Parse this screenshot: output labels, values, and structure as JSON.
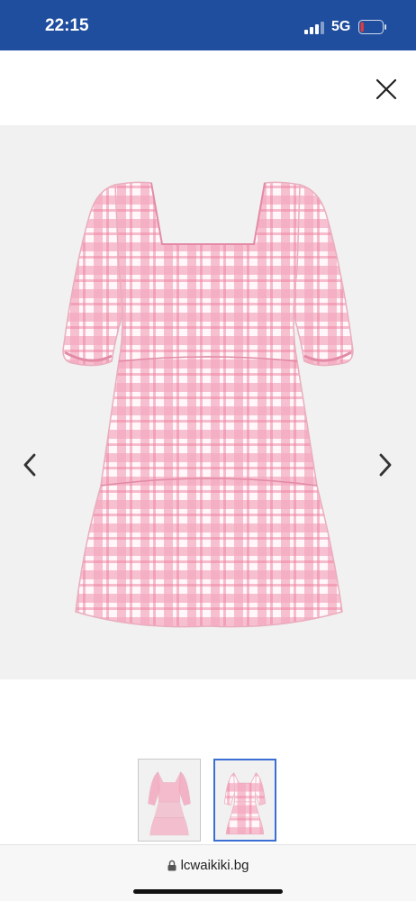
{
  "status_bar": {
    "time": "22:15",
    "network": "5G",
    "icons": [
      "signal-bars-icon",
      "battery-low-icon"
    ],
    "battery_level": 0.15,
    "colors": {
      "background": "#1f4e9e",
      "battery_fill": "#e23b3b"
    }
  },
  "viewer": {
    "close_icon": "close-icon",
    "prev_icon": "chevron-left-icon",
    "next_icon": "chevron-right-icon",
    "image_subject": "pink gingham tiered dress",
    "thumbnails": [
      {
        "selected": false
      },
      {
        "selected": true
      }
    ],
    "colors": {
      "gallery_bg": "#f1f1f1",
      "dress_pink": "#f4a9bf",
      "selected_border": "#3b6fd4"
    }
  },
  "browser": {
    "url": "lcwaikiki.bg",
    "secure_icon": "lock-icon"
  }
}
